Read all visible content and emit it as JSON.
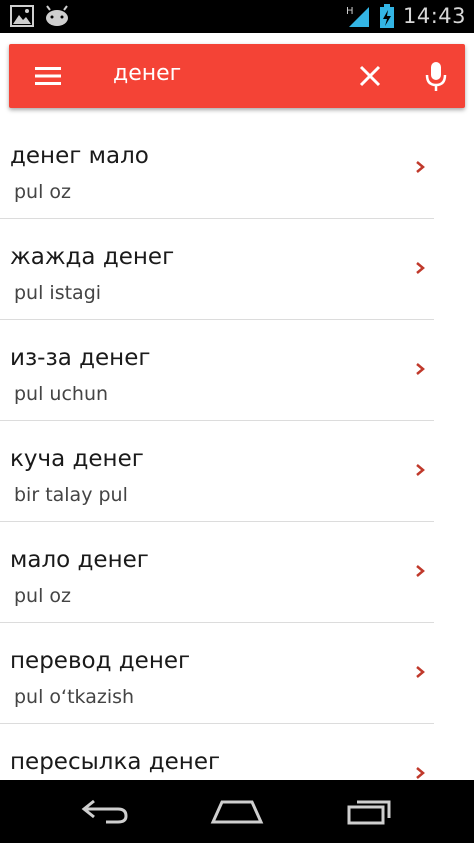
{
  "status_bar": {
    "time": "14:43",
    "network_letter": "H"
  },
  "app_bar": {
    "search_query": "денег"
  },
  "colors": {
    "accent": "#f44336",
    "chevron": "#c0392b"
  },
  "results": [
    {
      "primary": "денег мало",
      "secondary": "pul oz"
    },
    {
      "primary": "жажда денег",
      "secondary": "pul istagi"
    },
    {
      "primary": "из-за денег",
      "secondary": "pul uchun"
    },
    {
      "primary": "куча денег",
      "secondary": "bir talay pul"
    },
    {
      "primary": "мало денег",
      "secondary": "pul oz"
    },
    {
      "primary": "перевод денег",
      "secondary": "pul o‘tkazish"
    },
    {
      "primary": "пересылка денег",
      "secondary": ""
    }
  ]
}
